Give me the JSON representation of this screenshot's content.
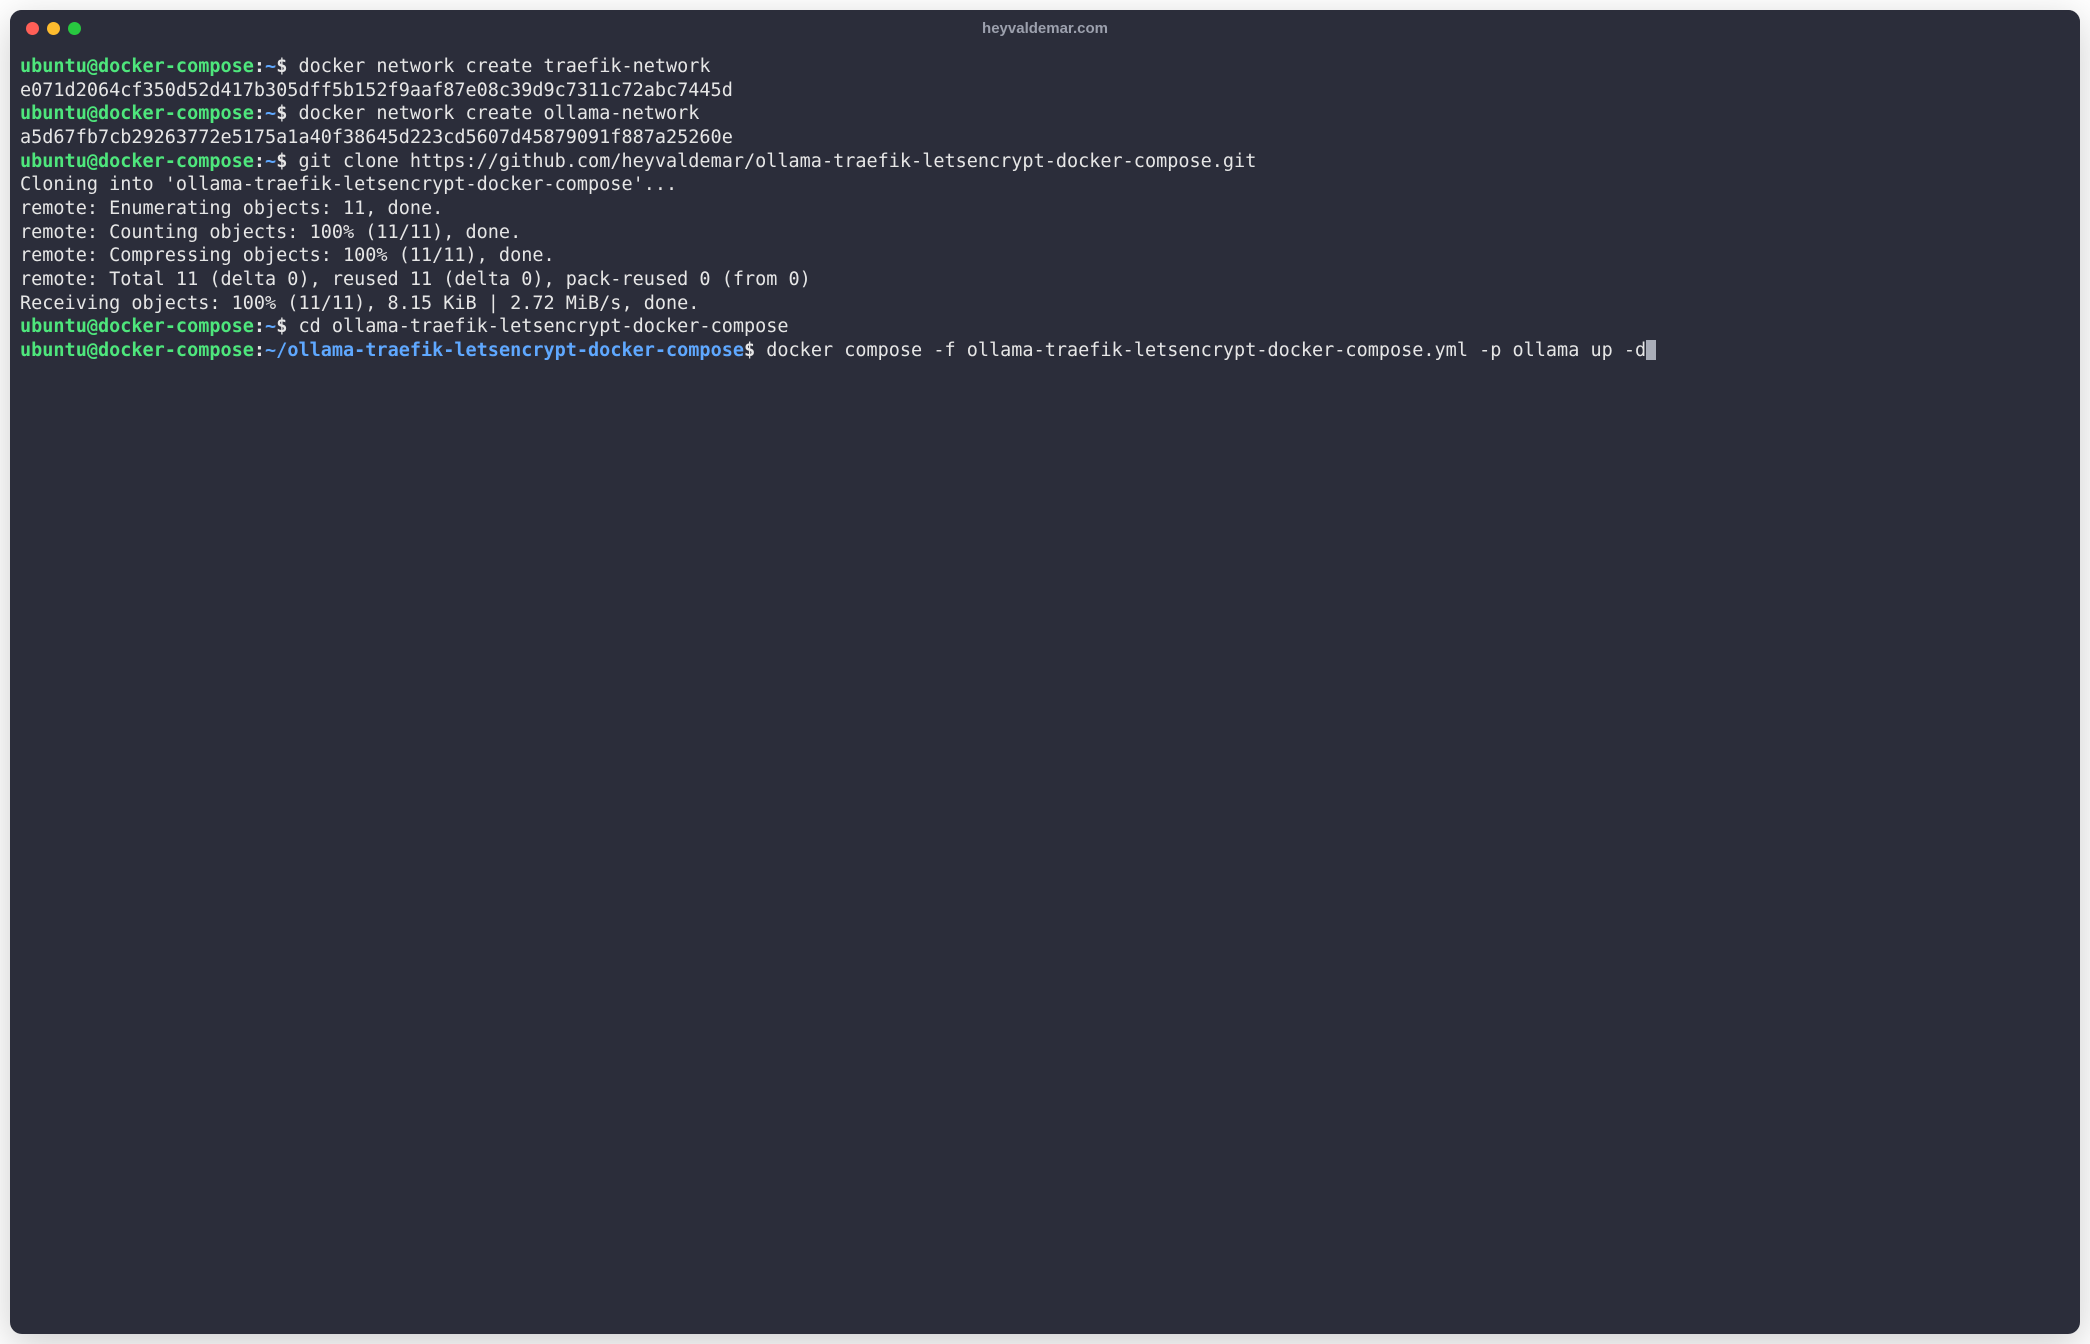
{
  "window": {
    "title": "heyvaldemar.com"
  },
  "prompt": {
    "user": "ubuntu",
    "at": "@",
    "host": "docker-compose",
    "colon": ":",
    "dollar": "$"
  },
  "lines": {
    "l1_path": "~",
    "l1_cmd": " docker network create traefik-network",
    "l2_out": "e071d2064cf350d52d417b305dff5b152f9aaf87e08c39d9c7311c72abc7445d",
    "l3_path": "~",
    "l3_cmd": " docker network create ollama-network",
    "l4_out": "a5d67fb7cb29263772e5175a1a40f38645d223cd5607d45879091f887a25260e",
    "l5_path": "~",
    "l5_cmd": " git clone https://github.com/heyvaldemar/ollama-traefik-letsencrypt-docker-compose.git",
    "l6_out": "Cloning into 'ollama-traefik-letsencrypt-docker-compose'...",
    "l7_out": "remote: Enumerating objects: 11, done.",
    "l8_out": "remote: Counting objects: 100% (11/11), done.",
    "l9_out": "remote: Compressing objects: 100% (11/11), done.",
    "l10_out": "remote: Total 11 (delta 0), reused 11 (delta 0), pack-reused 0 (from 0)",
    "l11_out": "Receiving objects: 100% (11/11), 8.15 KiB | 2.72 MiB/s, done.",
    "l12_path": "~",
    "l12_cmd": " cd ollama-traefik-letsencrypt-docker-compose",
    "l13_path": "~/ollama-traefik-letsencrypt-docker-compose",
    "l13_cmd": " docker compose -f ollama-traefik-letsencrypt-docker-compose.yml -p ollama up -d"
  }
}
